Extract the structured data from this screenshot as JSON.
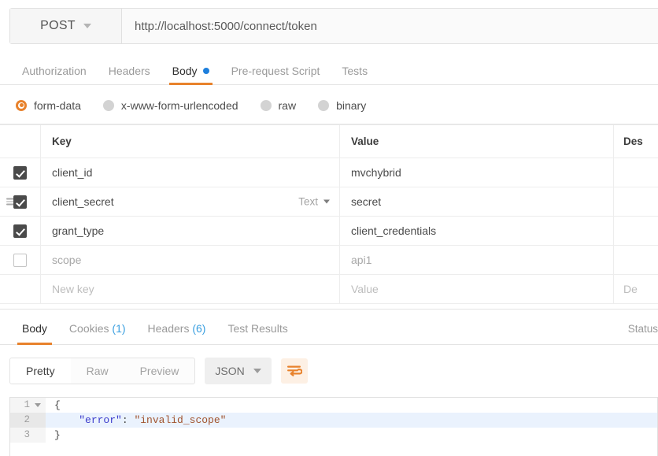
{
  "request": {
    "method": "POST",
    "url": "http://localhost:5000/connect/token",
    "tabs": [
      {
        "label": "Authorization",
        "active": false,
        "dot": false
      },
      {
        "label": "Headers",
        "active": false,
        "dot": false
      },
      {
        "label": "Body",
        "active": true,
        "dot": true
      },
      {
        "label": "Pre-request Script",
        "active": false,
        "dot": false
      },
      {
        "label": "Tests",
        "active": false,
        "dot": false
      }
    ],
    "body_modes": [
      {
        "label": "form-data",
        "selected": true
      },
      {
        "label": "x-www-form-urlencoded",
        "selected": false
      },
      {
        "label": "raw",
        "selected": false
      },
      {
        "label": "binary",
        "selected": false
      }
    ],
    "table": {
      "headers": {
        "key": "Key",
        "value": "Value",
        "description": "Des"
      },
      "rows": [
        {
          "checked": true,
          "key": "client_id",
          "value": "mvchybrid",
          "type": null,
          "handle": false,
          "new": false
        },
        {
          "checked": true,
          "key": "client_secret",
          "value": "secret",
          "type": "Text",
          "handle": true,
          "new": false
        },
        {
          "checked": true,
          "key": "grant_type",
          "value": "client_credentials",
          "type": null,
          "handle": false,
          "new": false
        },
        {
          "checked": false,
          "key": "scope",
          "value": "api1",
          "type": null,
          "handle": false,
          "new": false
        }
      ],
      "new_row": {
        "key_placeholder": "New key",
        "value_placeholder": "Value",
        "desc_placeholder": "De"
      }
    }
  },
  "response": {
    "tabs": [
      {
        "label": "Body",
        "count": null,
        "active": true
      },
      {
        "label": "Cookies",
        "count": "(1)",
        "active": false
      },
      {
        "label": "Headers",
        "count": "(6)",
        "active": false
      },
      {
        "label": "Test Results",
        "count": null,
        "active": false
      }
    ],
    "status_label": "Status",
    "view_modes": [
      {
        "label": "Pretty",
        "active": true
      },
      {
        "label": "Raw",
        "active": false
      },
      {
        "label": "Preview",
        "active": false
      }
    ],
    "language": "JSON",
    "format_icon": "wrap-lines-icon",
    "code": {
      "lines": [
        {
          "num": "1",
          "fold": true,
          "highlight": false,
          "open": "{"
        },
        {
          "num": "2",
          "fold": false,
          "highlight": true,
          "key": "\"error\"",
          "colon": ": ",
          "value": "\"invalid_scope\""
        },
        {
          "num": "3",
          "fold": false,
          "highlight": false,
          "close": "}"
        }
      ]
    }
  },
  "colors": {
    "accent": "#e8822c",
    "dot_blue": "#1e7fdc",
    "count_blue": "#3a9fe0",
    "highlight": "#eaf2fd",
    "json_key": "#3c3ccc",
    "json_value": "#a0522d"
  }
}
